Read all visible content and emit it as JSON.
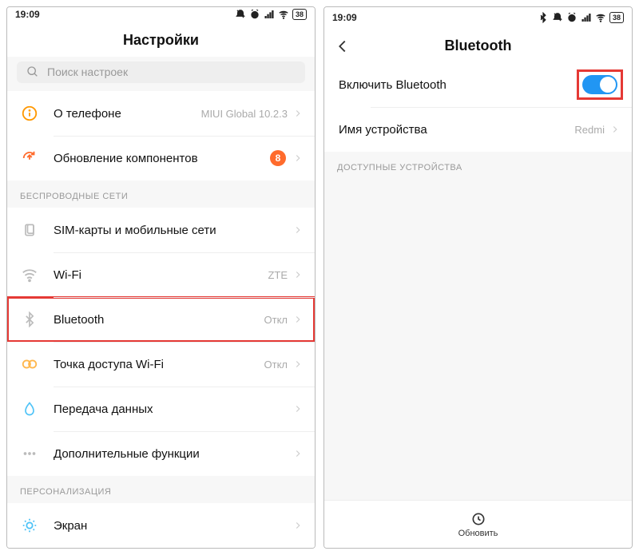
{
  "status": {
    "time": "19:09",
    "battery": "38"
  },
  "left": {
    "title": "Настройки",
    "search_placeholder": "Поиск настроек",
    "about_label": "О телефоне",
    "about_value": "MIUI Global 10.2.3",
    "update_label": "Обновление компонентов",
    "update_badge": "8",
    "section_wireless": "БЕСПРОВОДНЫЕ СЕТИ",
    "sim_label": "SIM-карты и мобильные сети",
    "wifi_label": "Wi-Fi",
    "wifi_value": "ZTE",
    "bt_label": "Bluetooth",
    "bt_value": "Откл",
    "hotspot_label": "Точка доступа Wi-Fi",
    "hotspot_value": "Откл",
    "data_label": "Передача данных",
    "more_label": "Дополнительные функции",
    "section_personal": "ПЕРСОНАЛИЗАЦИЯ",
    "display_label": "Экран"
  },
  "right": {
    "title": "Bluetooth",
    "enable_label": "Включить Bluetooth",
    "device_name_label": "Имя устройства",
    "device_name_value": "Redmi",
    "available_label": "ДОСТУПНЫЕ УСТРОЙСТВА",
    "refresh_label": "Обновить"
  }
}
